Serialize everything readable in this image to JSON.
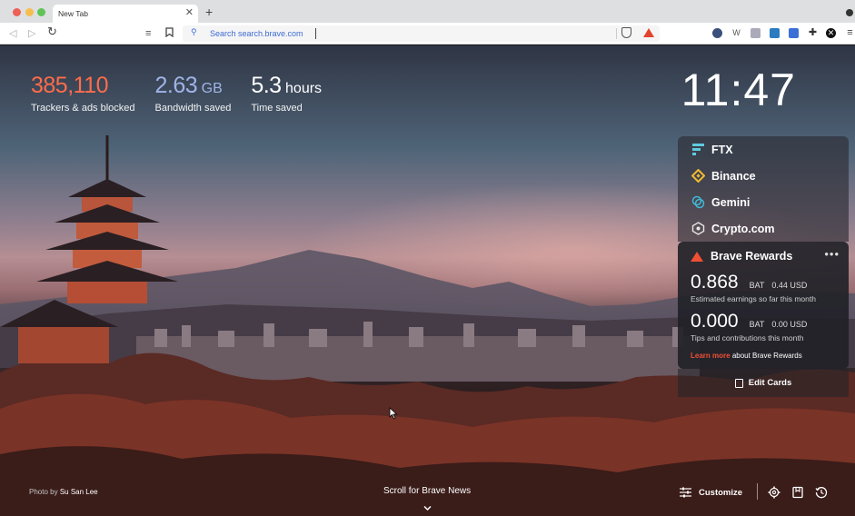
{
  "browser": {
    "tab_title": "New Tab",
    "tab_close": "✕",
    "new_tab": "+",
    "url_placeholder": "Search search.brave.com"
  },
  "stats": {
    "trackers_value": "385,110",
    "trackers_label": "Trackers & ads blocked",
    "bandwidth_value": "2.63",
    "bandwidth_unit": "GB",
    "bandwidth_label": "Bandwidth saved",
    "time_value": "5.3",
    "time_unit": "hours",
    "time_label": "Time saved"
  },
  "clock": "11:47",
  "cards": [
    {
      "label": "FTX",
      "icon": "ftx-icon"
    },
    {
      "label": "Binance",
      "icon": "binance-icon"
    },
    {
      "label": "Gemini",
      "icon": "gemini-icon"
    },
    {
      "label": "Crypto.com",
      "icon": "crypto-com-icon"
    }
  ],
  "rewards": {
    "title": "Brave Rewards",
    "more": "•••",
    "earnings_value": "0.868",
    "earnings_bat": "BAT",
    "earnings_usd": "0.44 USD",
    "earnings_label": "Estimated earnings so far this month",
    "tips_value": "0.000",
    "tips_bat": "BAT",
    "tips_usd": "0.00 USD",
    "tips_label": "Tips and contributions this month",
    "learn_more": "Learn more",
    "learn_rest": "about Brave Rewards"
  },
  "edit_cards": "Edit Cards",
  "footer": {
    "photo_by": "Photo by",
    "photographer": "Su San Lee",
    "scroll_news": "Scroll for Brave News",
    "customize": "Customize"
  },
  "colors": {
    "trackers": "#ff6c4a",
    "bandwidth": "#a0b4e8",
    "brave_orange": "#ef4f33"
  }
}
